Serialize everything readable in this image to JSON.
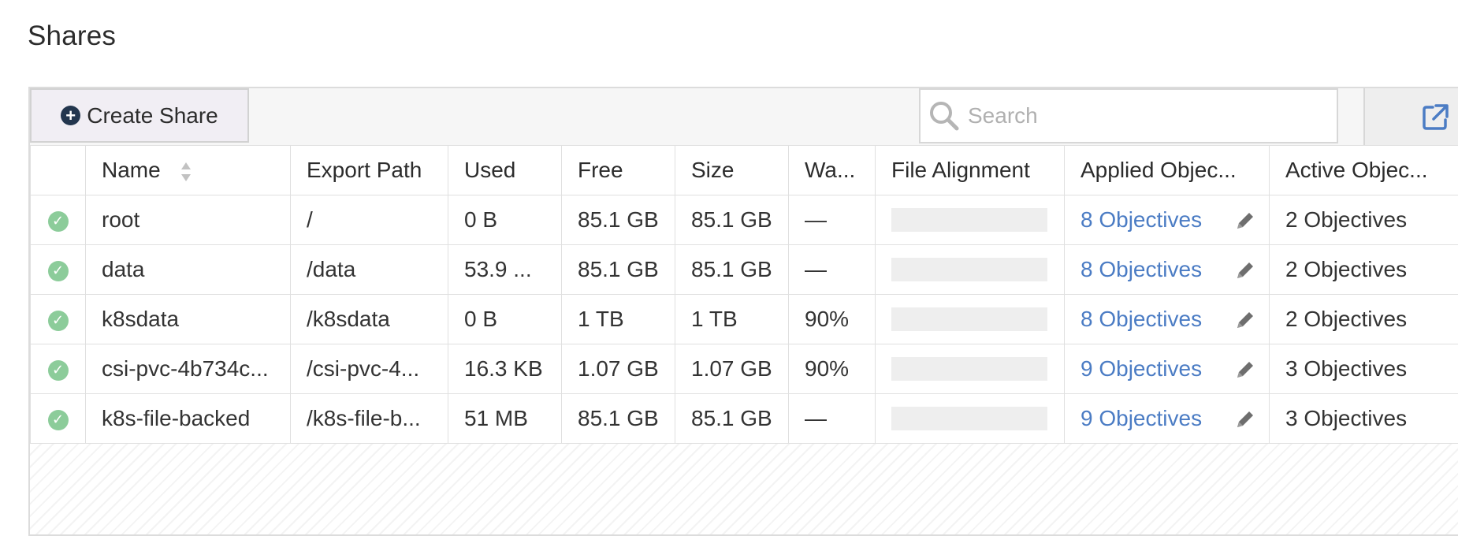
{
  "page": {
    "title": "Shares"
  },
  "toolbar": {
    "create_label": "Create Share",
    "search_placeholder": "Search",
    "search_value": ""
  },
  "columns": {
    "name": "Name",
    "export_path": "Export Path",
    "used": "Used",
    "free": "Free",
    "size": "Size",
    "warn": "Wa...",
    "file_alignment": "File Alignment",
    "applied_objectives": "Applied Objec...",
    "active_objectives": "Active Objec..."
  },
  "rows": [
    {
      "name": "root",
      "export_path": "/",
      "used": "0 B",
      "free": "85.1 GB",
      "size": "85.1 GB",
      "warn": "—",
      "alignment": 0,
      "applied": "8 Objectives",
      "active": "2 Objectives"
    },
    {
      "name": "data",
      "export_path": "/data",
      "used": "53.9 ...",
      "free": "85.1 GB",
      "size": "85.1 GB",
      "warn": "—",
      "alignment": 1,
      "applied": "8 Objectives",
      "active": "2 Objectives"
    },
    {
      "name": "k8sdata",
      "export_path": "/k8sdata",
      "used": "0 B",
      "free": "1 TB",
      "size": "1 TB",
      "warn": "90%",
      "alignment": 0,
      "applied": "8 Objectives",
      "active": "2 Objectives"
    },
    {
      "name": "csi-pvc-4b734c...",
      "export_path": "/csi-pvc-4...",
      "used": "16.3 KB",
      "free": "1.07 GB",
      "size": "1.07 GB",
      "warn": "90%",
      "alignment": 1,
      "applied": "9 Objectives",
      "active": "3 Objectives"
    },
    {
      "name": "k8s-file-backed",
      "export_path": "/k8s-file-b...",
      "used": "51 MB",
      "free": "85.1 GB",
      "size": "85.1 GB",
      "warn": "—",
      "alignment": 1,
      "applied": "9 Objectives",
      "active": "3 Objectives"
    }
  ],
  "colors": {
    "link": "#4b7cc4",
    "status_ok": "#8ccc9a",
    "alignment_fill": "#acd5a4",
    "alignment_empty": "#eeeeee"
  }
}
